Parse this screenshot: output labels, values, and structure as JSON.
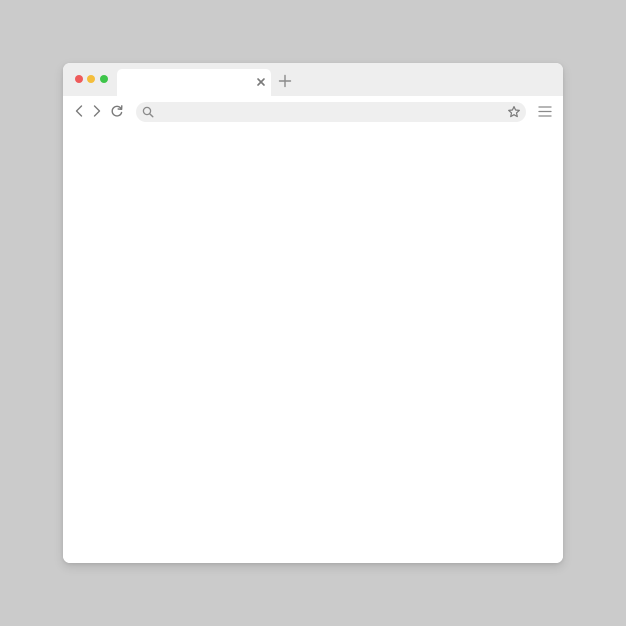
{
  "window": {
    "background": "#ffffff",
    "page_background": "#cbcbcb",
    "chrome_color": "#eeeeee"
  },
  "traffic_lights": {
    "close_color": "#ee5b5b",
    "minimize_color": "#f4be3c",
    "maximize_color": "#3ec54a"
  },
  "tab": {
    "title": "",
    "close_icon": "close-icon"
  },
  "new_tab": {
    "icon": "plus-icon"
  },
  "toolbar": {
    "back_icon": "chevron-left-icon",
    "forward_icon": "chevron-right-icon",
    "reload_icon": "reload-icon",
    "menu_icon": "hamburger-menu-icon"
  },
  "address_bar": {
    "value": "",
    "placeholder": "",
    "search_icon": "search-icon",
    "bookmark_icon": "star-icon"
  },
  "content": {
    "text": ""
  }
}
